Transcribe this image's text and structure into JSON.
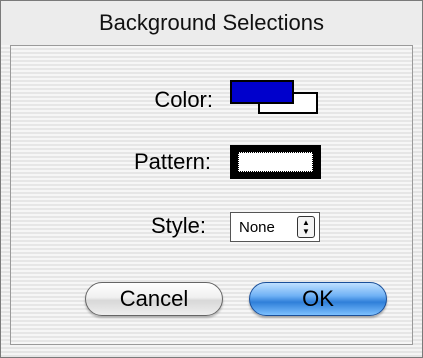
{
  "window": {
    "title": "Background Selections"
  },
  "fields": {
    "color_label": "Color:",
    "pattern_label": "Pattern:",
    "style_label": "Style:"
  },
  "color": {
    "foreground": "#0000cc",
    "background": "#ffffff"
  },
  "style_popup": {
    "value": "None",
    "icon": "up-down-arrows-icon"
  },
  "buttons": {
    "cancel_label": "Cancel",
    "ok_label": "OK"
  }
}
